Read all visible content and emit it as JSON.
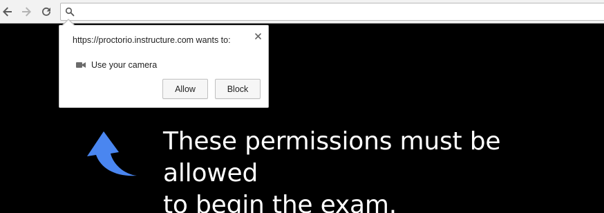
{
  "browser": {
    "nav": {
      "back_icon": "arrow-left-icon",
      "forward_icon": "arrow-right-icon",
      "reload_icon": "reload-icon"
    },
    "omnibox": {
      "icon": "search-icon",
      "value": "",
      "placeholder": ""
    }
  },
  "permission_prompt": {
    "title": "https://proctorio.instructure.com wants to:",
    "permission": {
      "icon": "video-camera-icon",
      "label": "Use your camera"
    },
    "close_icon": "close-icon",
    "buttons": {
      "allow": "Allow",
      "block": "Block"
    }
  },
  "instructions": {
    "arrow_icon": "curved-arrow-up-left-icon",
    "line1": "These permissions must be allowed",
    "line2": "to begin the exam."
  },
  "colors": {
    "background": "#000000",
    "arrow": "#4a86f0",
    "message_text": "#ffffff",
    "toolbar": "#f2f2f2"
  }
}
